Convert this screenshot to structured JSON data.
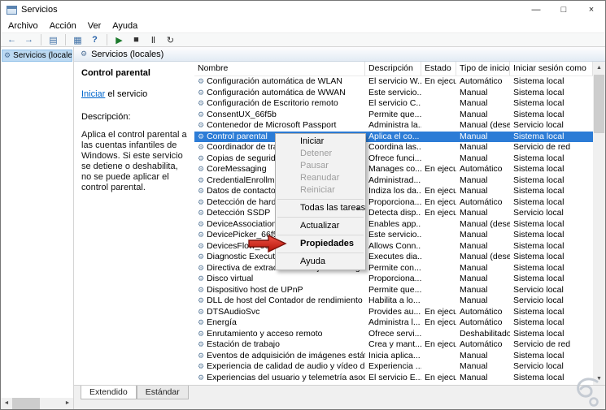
{
  "window": {
    "title": "Servicios",
    "minimize_glyph": "—",
    "maximize_glyph": "□",
    "close_glyph": "×"
  },
  "menu_bar": {
    "items": [
      "Archivo",
      "Acción",
      "Ver",
      "Ayuda"
    ]
  },
  "toolbar": {
    "buttons": [
      {
        "name": "back-icon",
        "glyph": "←",
        "enabled": true
      },
      {
        "name": "forward-icon",
        "glyph": "→",
        "enabled": true
      },
      {
        "separator": true
      },
      {
        "name": "show-console-tree-icon",
        "glyph": "▤",
        "enabled": true
      },
      {
        "separator": true
      },
      {
        "name": "properties-icon",
        "glyph": "▦",
        "enabled": true
      },
      {
        "name": "help-icon",
        "glyph": "?",
        "enabled": true,
        "cls": "help"
      },
      {
        "separator": true
      },
      {
        "name": "start-service-icon",
        "glyph": "▶",
        "enabled": true,
        "cls": "play"
      },
      {
        "name": "stop-service-icon",
        "glyph": "■",
        "enabled": true,
        "cls": "dark"
      },
      {
        "name": "pause-service-icon",
        "glyph": "Ⅱ",
        "enabled": true,
        "cls": "dark"
      },
      {
        "name": "restart-service-icon",
        "glyph": "↻",
        "enabled": true,
        "cls": "dark"
      }
    ]
  },
  "left_panel": {
    "item": "Servicios (locales)",
    "icon": "⚙"
  },
  "header_bar": {
    "title": "Servicios (locales)",
    "icon": "⚙"
  },
  "description_panel": {
    "service_title": "Control parental",
    "start_link": "Iniciar",
    "start_suffix": " el servicio",
    "description_label": "Descripción:",
    "description_text": "Aplica el control parental a las cuentas infantiles de Windows. Si este servicio se detiene o deshabilita, no se puede aplicar el control parental."
  },
  "table": {
    "columns": [
      "Nombre",
      "Descripción",
      "Estado",
      "Tipo de inicio",
      "Iniciar sesión como"
    ],
    "row_icon": "⚙",
    "rows": [
      {
        "name": "Configuración automática de WLAN",
        "description": "El servicio W...",
        "status": "En ejecu...",
        "startup": "Automático",
        "logon": "Sistema local"
      },
      {
        "name": "Configuración automática de WWAN",
        "description": "Este servicio...",
        "status": "",
        "startup": "Manual",
        "logon": "Sistema local"
      },
      {
        "name": "Configuración de Escritorio remoto",
        "description": "El servicio C...",
        "status": "",
        "startup": "Manual",
        "logon": "Sistema local"
      },
      {
        "name": "ConsentUX_66f5b",
        "description": "Permite que...",
        "status": "",
        "startup": "Manual",
        "logon": "Sistema local"
      },
      {
        "name": "Contenedor de Microsoft Passport",
        "description": "Administra la...",
        "status": "",
        "startup": "Manual (dese...",
        "logon": "Servicio local"
      },
      {
        "name": "Control parental",
        "description": "Aplica el co...",
        "status": "",
        "startup": "Manual",
        "logon": "Sistema local",
        "selected": true
      },
      {
        "name": "Coordinador de tra",
        "description": "Coordina las...",
        "status": "",
        "startup": "Manual",
        "logon": "Servicio de red"
      },
      {
        "name": "Copias de seguridad",
        "description": "Ofrece funci...",
        "status": "",
        "startup": "Manual",
        "logon": "Sistema local"
      },
      {
        "name": "CoreMessaging",
        "description": "Manages co...",
        "status": "En ejecu...",
        "startup": "Automático",
        "logon": "Sistema local"
      },
      {
        "name": "CredentialEnrollm",
        "description": "Administrad...",
        "status": "",
        "startup": "Manual",
        "logon": "Sistema local"
      },
      {
        "name": "Datos de contactos",
        "description": "Indiza los da...",
        "status": "En ejecu...",
        "startup": "Manual",
        "logon": "Sistema local"
      },
      {
        "name": "Detección de hardw",
        "description": "Proporciona...",
        "status": "En ejecu...",
        "startup": "Automático",
        "logon": "Sistema local"
      },
      {
        "name": "Detección SSDP",
        "description": "Detecta disp...",
        "status": "En ejecu...",
        "startup": "Manual",
        "logon": "Servicio local"
      },
      {
        "name": "DeviceAssociationS",
        "description": "Enables app...",
        "status": "",
        "startup": "Manual (dese...",
        "logon": "Sistema local"
      },
      {
        "name": "DevicePicker_66f5",
        "description": "Este servicio...",
        "status": "",
        "startup": "Manual",
        "logon": "Sistema local"
      },
      {
        "name": "DevicesFlow_66f5",
        "description": "Allows Conn...",
        "status": "",
        "startup": "Manual",
        "logon": "Sistema local"
      },
      {
        "name": "Diagnostic Executio",
        "description": "Executes dia...",
        "status": "",
        "startup": "Manual (dese...",
        "logon": "Sistema local"
      },
      {
        "name": "Directiva de extracción de tarjetas inteligentes",
        "description": "Permite con...",
        "status": "",
        "startup": "Manual",
        "logon": "Sistema local"
      },
      {
        "name": "Disco virtual",
        "description": "Proporciona...",
        "status": "",
        "startup": "Manual",
        "logon": "Sistema local"
      },
      {
        "name": "Dispositivo host de UPnP",
        "description": "Permite que...",
        "status": "",
        "startup": "Manual",
        "logon": "Servicio local"
      },
      {
        "name": "DLL de host del Contador de rendimiento",
        "description": "Habilita a lo...",
        "status": "",
        "startup": "Manual",
        "logon": "Servicio local"
      },
      {
        "name": "DTSAudioSvc",
        "description": "Provides au...",
        "status": "En ejecu...",
        "startup": "Automático",
        "logon": "Sistema local"
      },
      {
        "name": "Energía",
        "description": "Administra l...",
        "status": "En ejecu...",
        "startup": "Automático",
        "logon": "Sistema local"
      },
      {
        "name": "Enrutamiento y acceso remoto",
        "description": "Ofrece servi...",
        "status": "",
        "startup": "Deshabilitado",
        "logon": "Sistema local"
      },
      {
        "name": "Estación de trabajo",
        "description": "Crea y mant...",
        "status": "En ejecu...",
        "startup": "Automático",
        "logon": "Servicio de red"
      },
      {
        "name": "Eventos de adquisición de imágenes estáticas",
        "description": "Inicia aplica...",
        "status": "",
        "startup": "Manual",
        "logon": "Sistema local"
      },
      {
        "name": "Experiencia de calidad de audio y vídeo de Wind...",
        "description": "Experiencia ...",
        "status": "",
        "startup": "Manual",
        "logon": "Servicio local"
      },
      {
        "name": "Experiencias del usuario y telemetría asociadas",
        "description": "El servicio E...",
        "status": "En ejecu...",
        "startup": "Manual",
        "logon": "Sistema local"
      }
    ]
  },
  "context_menu": {
    "submenu_glyph": "▸",
    "items": [
      {
        "label": "Iniciar",
        "enabled": true
      },
      {
        "label": "Detener",
        "enabled": false
      },
      {
        "label": "Pausar",
        "enabled": false
      },
      {
        "label": "Reanudar",
        "enabled": false
      },
      {
        "label": "Reiniciar",
        "enabled": false
      },
      {
        "separator": true
      },
      {
        "label": "Todas las tareas",
        "enabled": true,
        "submenu": true
      },
      {
        "separator": true
      },
      {
        "label": "Actualizar",
        "enabled": true
      },
      {
        "separator": true
      },
      {
        "label": "Propiedades",
        "enabled": true,
        "default": true
      },
      {
        "separator": true
      },
      {
        "label": "Ayuda",
        "enabled": true
      }
    ]
  },
  "tabs": {
    "items": [
      {
        "label": "Extendido",
        "active": true
      },
      {
        "label": "Estándar",
        "active": false
      }
    ]
  },
  "scrollbars": {
    "up": "▲",
    "down": "▼",
    "left": "◄",
    "right": "►"
  },
  "colors": {
    "selection": "#2c7cd6",
    "link": "#0066cc",
    "arrow_red": "#d3271d"
  }
}
